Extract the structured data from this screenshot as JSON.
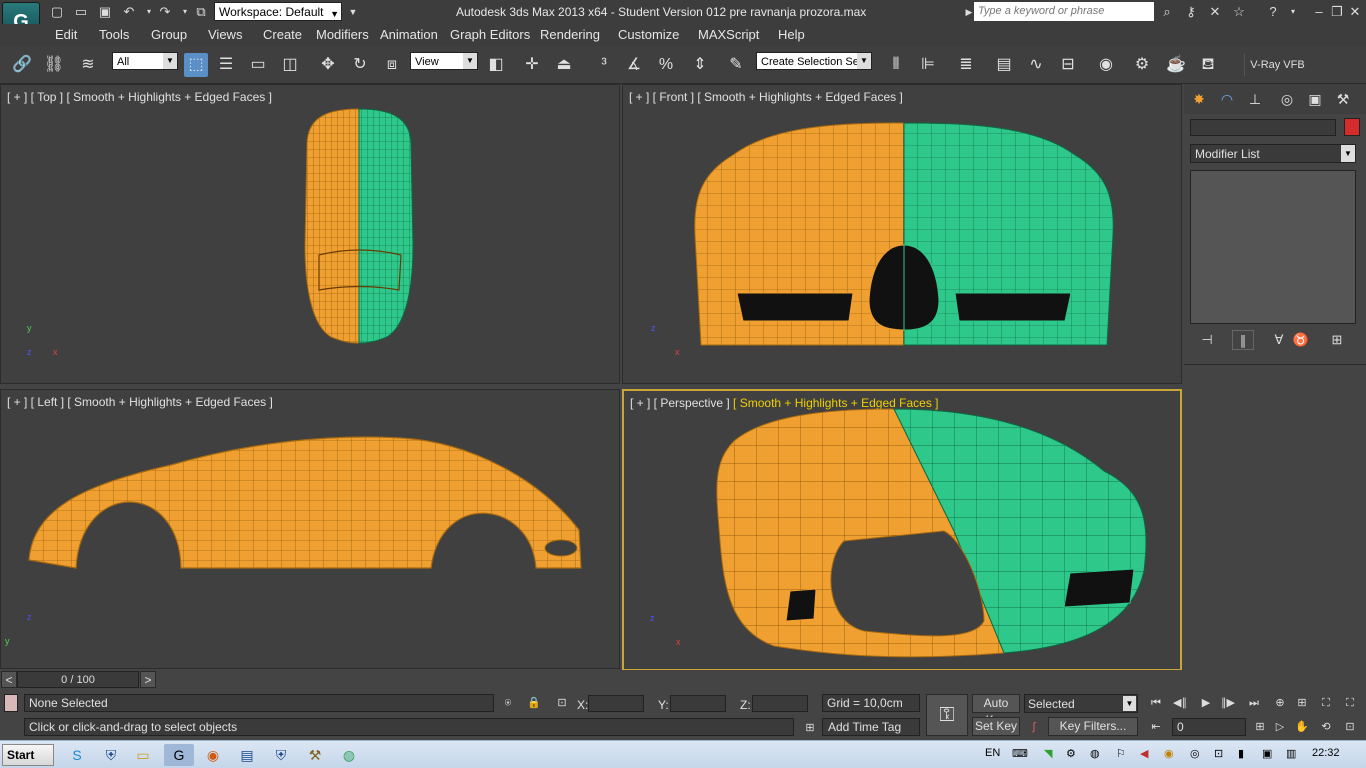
{
  "titlebar": {
    "app_title": "Autodesk 3ds Max  2013 x64  - Student Version   012 pre ravnanja prozora.max",
    "workspace": "Workspace: Default",
    "search_placeholder": "Type a keyword or phrase"
  },
  "menu": [
    "Edit",
    "Tools",
    "Group",
    "Views",
    "Create",
    "Modifiers",
    "Animation",
    "Graph Editors",
    "Rendering",
    "Customize",
    "MAXScript",
    "Help"
  ],
  "toolbar": {
    "filter_value": "All",
    "refcoord_value": "View",
    "selection_set_placeholder": "Create Selection Se",
    "vray_vfb": "V-Ray VFB"
  },
  "viewports": {
    "top": {
      "prefix": "[ + ] [ Top ] ",
      "mode": "[ Smooth + Highlights + Edged Faces ]"
    },
    "front": {
      "prefix": "[ + ] [ Front ] ",
      "mode": "[ Smooth + Highlights + Edged Faces ]"
    },
    "left": {
      "prefix": "[ + ] [ Left ] ",
      "mode": "[ Smooth + Highlights + Edged Faces ]"
    },
    "perspective": {
      "prefix": "[ + ] [ Perspective ] ",
      "mode": "[ Smooth + Highlights + Edged Faces ]"
    },
    "colors": {
      "orange": "#f0a030",
      "teal": "#2ec88a",
      "active_border": "#c9a53a"
    }
  },
  "command_panel": {
    "modifier_list": "Modifier List",
    "object_color": "#d42c2c"
  },
  "timeline": {
    "frame_display": "0 / 100",
    "prev": "<",
    "next": ">"
  },
  "status": {
    "selection": "None Selected",
    "prompt": "Click or click-and-drag to select objects",
    "x_label": "X:",
    "y_label": "Y:",
    "z_label": "Z:",
    "grid": "Grid = 10,0cm",
    "add_time_tag": "Add Time Tag",
    "auto_key": "Auto Key",
    "set_key": "Set Key",
    "selected_value": "Selected",
    "key_filters": "Key Filters...",
    "frame_value": "0"
  },
  "taskbar": {
    "start": "Start",
    "lang": "EN",
    "clock": "22:32"
  }
}
